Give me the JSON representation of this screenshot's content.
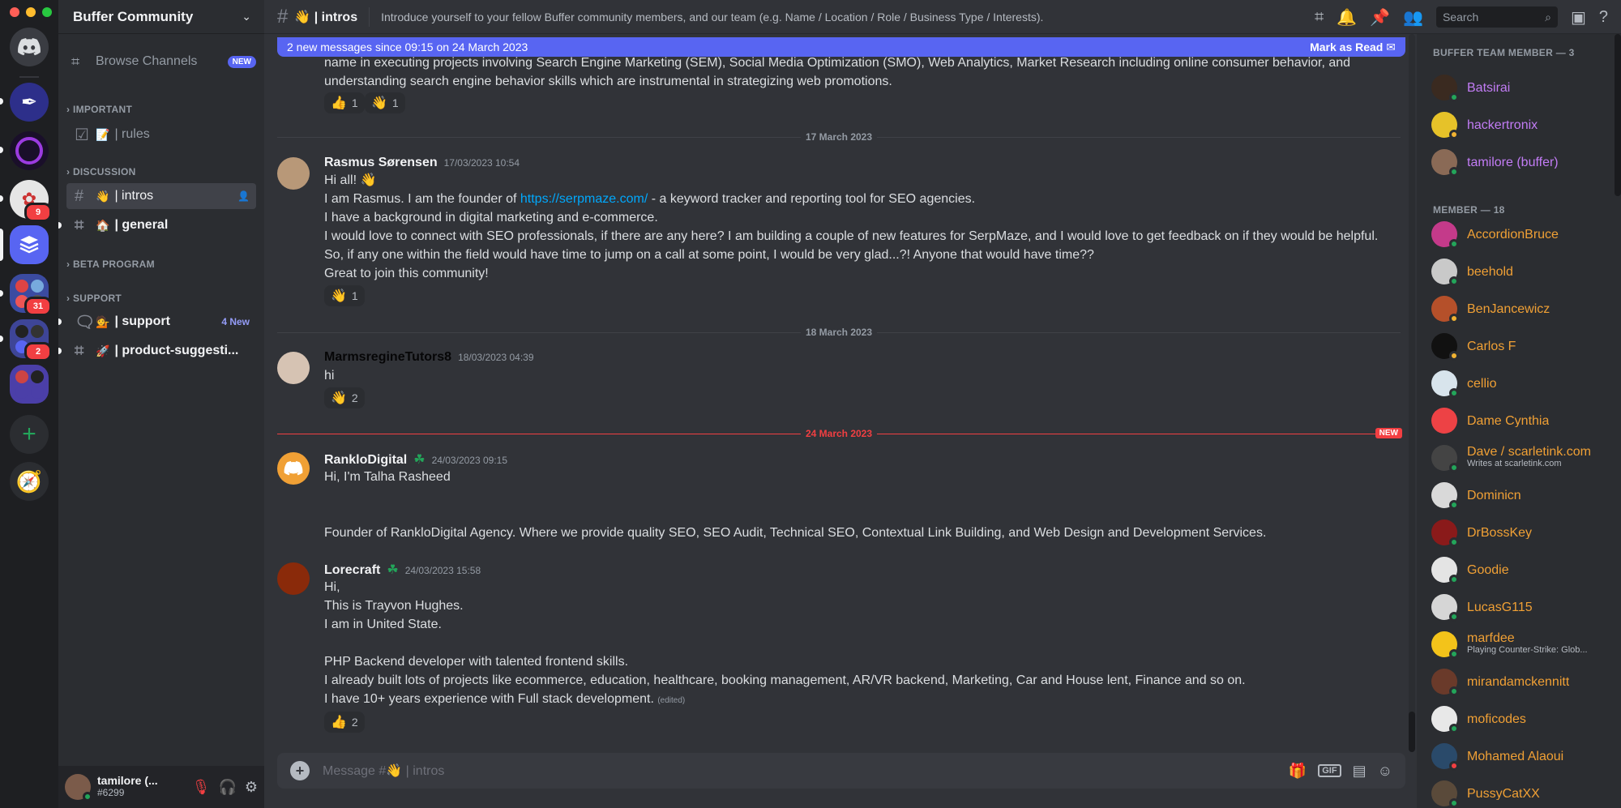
{
  "window": {
    "traffic_colors": [
      "#ff5f57",
      "#febc2e",
      "#28c840"
    ]
  },
  "servers": [
    {
      "name": "discord-home",
      "color": "#5865f2",
      "badge": ""
    },
    {
      "name": "quill-server",
      "color": "#3b3d9e",
      "badge": ""
    },
    {
      "name": "ring-server",
      "color": "#2a1b3d",
      "badge": ""
    },
    {
      "name": "sketch-server",
      "color": "#d9d9d9",
      "badge": "9"
    },
    {
      "name": "buffer-server",
      "color": "#5865f2",
      "badge": ""
    },
    {
      "name": "group-server-a",
      "color": "#3b4ba1",
      "badge": "31"
    },
    {
      "name": "group-server-b",
      "color": "#3e4597",
      "badge": "2"
    },
    {
      "name": "group-server-c",
      "color": "#4b3fa8",
      "badge": ""
    }
  ],
  "guild": {
    "name": "Buffer Community"
  },
  "sidebar": {
    "browse_label": "Browse Channels",
    "browse_badge": "NEW",
    "categories": {
      "important": "IMPORTANT",
      "discussion": "DISCUSSION",
      "beta": "BETA PROGRAM",
      "support": "SUPPORT"
    },
    "channels": {
      "rules": {
        "emoji": "📝",
        "name": "| rules"
      },
      "intros": {
        "emoji": "👋",
        "name": "| intros"
      },
      "general": {
        "emoji": "🏠",
        "name": "| general"
      },
      "support": {
        "emoji": "💁",
        "name": "| support",
        "new": "4 New"
      },
      "product": {
        "emoji": "🚀",
        "name": "| product-suggesti..."
      }
    }
  },
  "user": {
    "name": "tamilore (...",
    "tag": "#6299"
  },
  "header": {
    "channel": "👋 | intros",
    "topic": "Introduce yourself to your fellow Buffer community members, and our team (e.g. Name / Location / Role / Business Type / Interests).",
    "search_placeholder": "Search"
  },
  "banner": {
    "text": "2 new messages since 09:15 on 24 March 2023",
    "action": "Mark as Read"
  },
  "messages": {
    "prev_lines": [
      "name in executing projects involving Search Engine Marketing (SEM), Social Media Optimization (SMO), Web Analytics, Market Research including online consumer behavior, and",
      "understanding search engine behavior skills which are instrumental in strategizing web promotions."
    ],
    "prev_reactions": [
      {
        "emoji": "👍",
        "count": "1"
      },
      {
        "emoji": "👋",
        "count": "1"
      }
    ],
    "date1": "17 March 2023",
    "m1": {
      "author": "Rasmus Sørensen",
      "time": "17/03/2023 10:54",
      "line1": "Hi all! 👋",
      "line2_a": "I am Rasmus. I am the founder of ",
      "line2_link": "https://serpmaze.com/",
      "line2_b": " - a keyword tracker and reporting tool for SEO agencies.",
      "line3": "I have a background in digital marketing and e-commerce.",
      "line4": "I would love to connect with SEO professionals, if there are any here? I am building a couple of new features for SerpMaze, and I would love to get feedback on if they would be helpful.",
      "line5": "So, if any one within the field would have time to jump on a call at some point, I would be very glad...?! Anyone that would have time??",
      "line6": "Great to join this community!",
      "reaction": {
        "emoji": "👋",
        "count": "1"
      }
    },
    "date2": "18 March 2023",
    "m2": {
      "author": "MarmsregineTutors8",
      "time": "18/03/2023 04:39",
      "line1": "hi",
      "reaction": {
        "emoji": "👋",
        "count": "2"
      }
    },
    "date3": "24 March 2023",
    "new_tag": "NEW",
    "m3": {
      "author": "RankloDigital",
      "time": "24/03/2023 09:15",
      "line1": "Hi, I'm Talha Rasheed",
      "line2": "Founder of RankloDigital Agency. Where we provide quality SEO, SEO Audit, Technical SEO, Contextual Link Building, and Web Design and Development Services."
    },
    "m4": {
      "author": "Lorecraft",
      "time": "24/03/2023 15:58",
      "line1": "Hi,",
      "line2": "This is Trayvon Hughes.",
      "line3": "I am in United State.",
      "line4": "PHP Backend developer with talented frontend skills.",
      "line5": "I already built lots of projects like ecommerce, education, healthcare, booking management, AR/VR backend, Marketing, Car and House lent, Finance and so on.",
      "line6": "I have 10+ years experience with Full stack development.",
      "edited": "(edited)",
      "reaction": {
        "emoji": "👍",
        "count": "2"
      }
    }
  },
  "composer": {
    "placeholder": "Message #👋 | intros"
  },
  "members": {
    "team_header": "BUFFER TEAM MEMBER — 3",
    "member_header": "MEMBER — 18",
    "team": [
      {
        "name": "Batsirai",
        "color": "#c27cf5",
        "avatar": "#3a2a20",
        "status": "#23a55a"
      },
      {
        "name": "hackertronix",
        "color": "#c27cf5",
        "avatar": "#e6c229",
        "status": "#f0b232"
      },
      {
        "name": "tamilore (buffer)",
        "color": "#c27cf5",
        "avatar": "#8a6a56",
        "status": "#23a55a"
      }
    ],
    "list": [
      {
        "name": "AccordionBruce",
        "sub": "",
        "avatar": "#c43a8a",
        "status": "#23a55a"
      },
      {
        "name": "beehold",
        "sub": "",
        "avatar": "#c9c9c9",
        "status": "#23a55a"
      },
      {
        "name": "BenJancewicz",
        "sub": "",
        "avatar": "#b5502a",
        "status": "#f0b232"
      },
      {
        "name": "Carlos F",
        "sub": "",
        "avatar": "#111111",
        "status": "#f0b232"
      },
      {
        "name": "cellio",
        "sub": "",
        "avatar": "#d8e4ec",
        "status": "#23a55a"
      },
      {
        "name": "Dame Cynthia",
        "sub": "",
        "avatar": "#ed4245",
        "status": ""
      },
      {
        "name": "Dave / scarletink.com",
        "sub": "Writes at scarletink.com",
        "avatar": "#444444",
        "status": "#23a55a"
      },
      {
        "name": "Dominicn",
        "sub": "",
        "avatar": "#d9d9d9",
        "status": "#23a55a"
      },
      {
        "name": "DrBossKey",
        "sub": "",
        "avatar": "#8a1a1a",
        "status": "#23a55a"
      },
      {
        "name": "Goodie",
        "sub": "",
        "avatar": "#e4e4e4",
        "status": "#23a55a"
      },
      {
        "name": "LucasG115",
        "sub": "",
        "avatar": "#d6d6d6",
        "status": "#23a55a"
      },
      {
        "name": "marfdee",
        "sub": "Playing Counter-Strike: Glob...",
        "avatar": "#f3c31a",
        "status": "#23a55a"
      },
      {
        "name": "mirandamckennitt",
        "sub": "",
        "avatar": "#6a3a2a",
        "status": "#23a55a"
      },
      {
        "name": "moficodes",
        "sub": "",
        "avatar": "#e8e8e8",
        "status": "#23a55a"
      },
      {
        "name": "Mohamed Alaoui",
        "sub": "",
        "avatar": "#2a4a6a",
        "status": "#f23f42"
      },
      {
        "name": "PussyCatXX",
        "sub": "",
        "avatar": "#5a4a3a",
        "status": "#23a55a"
      }
    ],
    "member_color": "#f0a035"
  }
}
